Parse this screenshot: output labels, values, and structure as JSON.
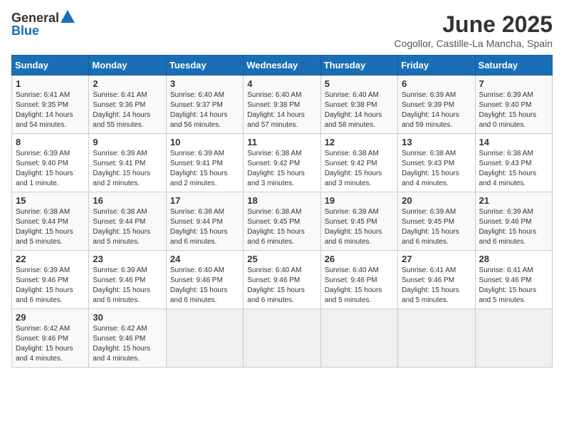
{
  "logo": {
    "general": "General",
    "blue": "Blue"
  },
  "title": "June 2025",
  "location": "Cogollor, Castille-La Mancha, Spain",
  "weekdays": [
    "Sunday",
    "Monday",
    "Tuesday",
    "Wednesday",
    "Thursday",
    "Friday",
    "Saturday"
  ],
  "weeks": [
    [
      {
        "day": "1",
        "info": "Sunrise: 6:41 AM\nSunset: 9:35 PM\nDaylight: 14 hours\nand 54 minutes."
      },
      {
        "day": "2",
        "info": "Sunrise: 6:41 AM\nSunset: 9:36 PM\nDaylight: 14 hours\nand 55 minutes."
      },
      {
        "day": "3",
        "info": "Sunrise: 6:40 AM\nSunset: 9:37 PM\nDaylight: 14 hours\nand 56 minutes."
      },
      {
        "day": "4",
        "info": "Sunrise: 6:40 AM\nSunset: 9:38 PM\nDaylight: 14 hours\nand 57 minutes."
      },
      {
        "day": "5",
        "info": "Sunrise: 6:40 AM\nSunset: 9:38 PM\nDaylight: 14 hours\nand 58 minutes."
      },
      {
        "day": "6",
        "info": "Sunrise: 6:39 AM\nSunset: 9:39 PM\nDaylight: 14 hours\nand 59 minutes."
      },
      {
        "day": "7",
        "info": "Sunrise: 6:39 AM\nSunset: 9:40 PM\nDaylight: 15 hours\nand 0 minutes."
      }
    ],
    [
      {
        "day": "8",
        "info": "Sunrise: 6:39 AM\nSunset: 9:40 PM\nDaylight: 15 hours\nand 1 minute."
      },
      {
        "day": "9",
        "info": "Sunrise: 6:39 AM\nSunset: 9:41 PM\nDaylight: 15 hours\nand 2 minutes."
      },
      {
        "day": "10",
        "info": "Sunrise: 6:39 AM\nSunset: 9:41 PM\nDaylight: 15 hours\nand 2 minutes."
      },
      {
        "day": "11",
        "info": "Sunrise: 6:38 AM\nSunset: 9:42 PM\nDaylight: 15 hours\nand 3 minutes."
      },
      {
        "day": "12",
        "info": "Sunrise: 6:38 AM\nSunset: 9:42 PM\nDaylight: 15 hours\nand 3 minutes."
      },
      {
        "day": "13",
        "info": "Sunrise: 6:38 AM\nSunset: 9:43 PM\nDaylight: 15 hours\nand 4 minutes."
      },
      {
        "day": "14",
        "info": "Sunrise: 6:38 AM\nSunset: 9:43 PM\nDaylight: 15 hours\nand 4 minutes."
      }
    ],
    [
      {
        "day": "15",
        "info": "Sunrise: 6:38 AM\nSunset: 9:44 PM\nDaylight: 15 hours\nand 5 minutes."
      },
      {
        "day": "16",
        "info": "Sunrise: 6:38 AM\nSunset: 9:44 PM\nDaylight: 15 hours\nand 5 minutes."
      },
      {
        "day": "17",
        "info": "Sunrise: 6:38 AM\nSunset: 9:44 PM\nDaylight: 15 hours\nand 6 minutes."
      },
      {
        "day": "18",
        "info": "Sunrise: 6:38 AM\nSunset: 9:45 PM\nDaylight: 15 hours\nand 6 minutes."
      },
      {
        "day": "19",
        "info": "Sunrise: 6:39 AM\nSunset: 9:45 PM\nDaylight: 15 hours\nand 6 minutes."
      },
      {
        "day": "20",
        "info": "Sunrise: 6:39 AM\nSunset: 9:45 PM\nDaylight: 15 hours\nand 6 minutes."
      },
      {
        "day": "21",
        "info": "Sunrise: 6:39 AM\nSunset: 9:46 PM\nDaylight: 15 hours\nand 6 minutes."
      }
    ],
    [
      {
        "day": "22",
        "info": "Sunrise: 6:39 AM\nSunset: 9:46 PM\nDaylight: 15 hours\nand 6 minutes."
      },
      {
        "day": "23",
        "info": "Sunrise: 6:39 AM\nSunset: 9:46 PM\nDaylight: 15 hours\nand 6 minutes."
      },
      {
        "day": "24",
        "info": "Sunrise: 6:40 AM\nSunset: 9:46 PM\nDaylight: 15 hours\nand 6 minutes."
      },
      {
        "day": "25",
        "info": "Sunrise: 6:40 AM\nSunset: 9:46 PM\nDaylight: 15 hours\nand 6 minutes."
      },
      {
        "day": "26",
        "info": "Sunrise: 6:40 AM\nSunset: 9:46 PM\nDaylight: 15 hours\nand 5 minutes."
      },
      {
        "day": "27",
        "info": "Sunrise: 6:41 AM\nSunset: 9:46 PM\nDaylight: 15 hours\nand 5 minutes."
      },
      {
        "day": "28",
        "info": "Sunrise: 6:41 AM\nSunset: 9:46 PM\nDaylight: 15 hours\nand 5 minutes."
      }
    ],
    [
      {
        "day": "29",
        "info": "Sunrise: 6:42 AM\nSunset: 9:46 PM\nDaylight: 15 hours\nand 4 minutes."
      },
      {
        "day": "30",
        "info": "Sunrise: 6:42 AM\nSunset: 9:46 PM\nDaylight: 15 hours\nand 4 minutes."
      },
      {
        "day": "",
        "info": ""
      },
      {
        "day": "",
        "info": ""
      },
      {
        "day": "",
        "info": ""
      },
      {
        "day": "",
        "info": ""
      },
      {
        "day": "",
        "info": ""
      }
    ]
  ]
}
